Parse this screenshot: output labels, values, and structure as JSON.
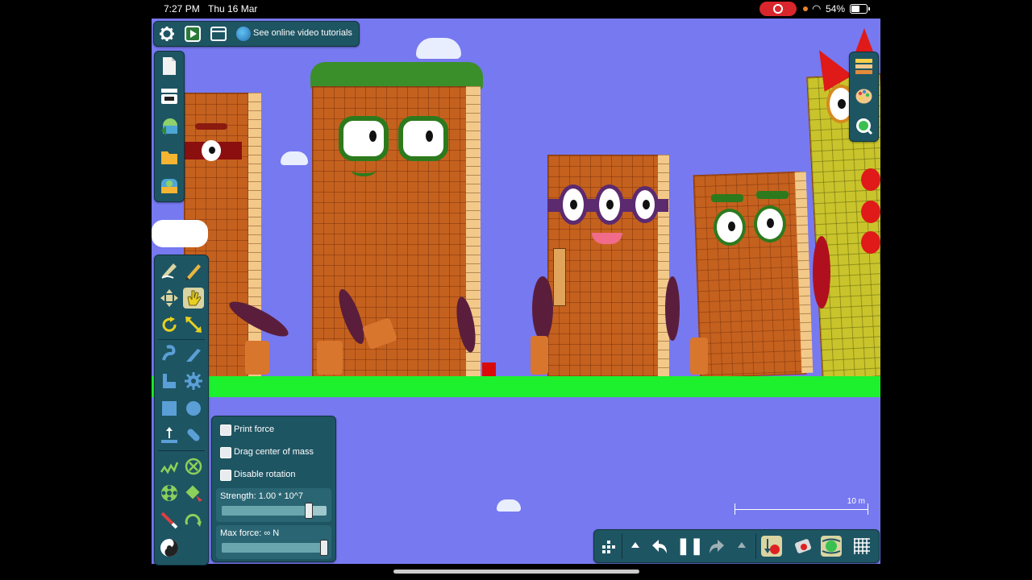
{
  "status_bar": {
    "time": "7:27 PM",
    "date": "Thu 16 Mar",
    "battery_percent": "54%",
    "battery_level": 0.54
  },
  "top_toolbar": {
    "tutorials_label": "See online video tutorials",
    "icons": [
      "gear-icon",
      "play-scene-icon",
      "window-icon",
      "globe-icon"
    ]
  },
  "file_panel": {
    "icons": [
      "new-file-icon",
      "save-icon",
      "load-icon",
      "folder-icon",
      "scene-thumb-icon"
    ]
  },
  "tools": {
    "selected": "hand-tool",
    "items": [
      "draw-tool",
      "pencil-tool",
      "move-tool",
      "hand-tool",
      "rotate-tool",
      "scale-tool",
      "rope-tool",
      "knife-tool",
      "polygon-tool",
      "gear-tool",
      "box-tool",
      "circle-tool",
      "plane-tool",
      "chain-tool",
      "spring-tool",
      "fixate-tool",
      "axle-tool",
      "thruster-tool",
      "laser-tool",
      "hinge-tool",
      "tracer-tool"
    ]
  },
  "options_panel": {
    "print_force": {
      "label": "Print force",
      "checked": false
    },
    "drag_center": {
      "label": "Drag center of mass",
      "checked": false
    },
    "disable_rotation": {
      "label": "Disable rotation",
      "checked": false
    },
    "strength": {
      "label": "Strength:  1.00 * 10^7",
      "level": 0.82
    },
    "max_force": {
      "label": "Max force:  ∞  N",
      "level": 1.0
    }
  },
  "scale_bar": {
    "label": "10 m"
  },
  "bottom_bar": {
    "icons": [
      "tools-menu-icon",
      "up-arrow-icon",
      "undo-icon",
      "pause-icon",
      "redo-icon",
      "up-arrow-icon",
      "gravity-icon",
      "erase-icon",
      "air-friction-icon",
      "grid-icon"
    ],
    "paused_symbol": "❚❚"
  },
  "right_panel": {
    "icons": [
      "layers-icon",
      "palette-icon",
      "zoom-icon"
    ]
  },
  "scene": {
    "sky_color": "#7779f0",
    "ground_color": "#1df02d"
  }
}
